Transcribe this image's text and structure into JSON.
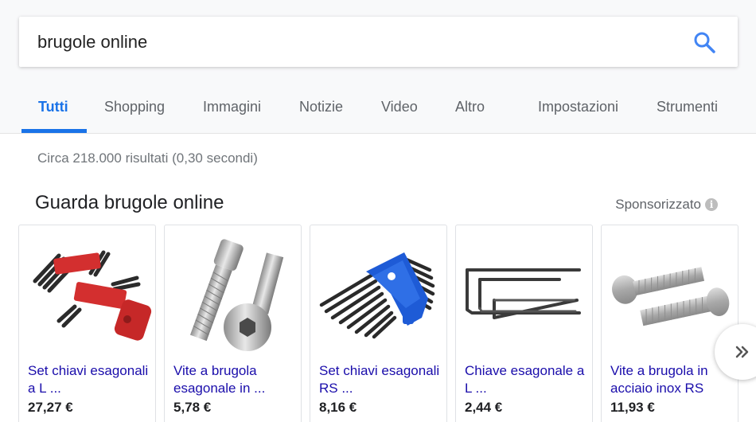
{
  "search": {
    "query": "brugole online"
  },
  "tabs": [
    {
      "label": "Tutti"
    },
    {
      "label": "Shopping"
    },
    {
      "label": "Immagini"
    },
    {
      "label": "Notizie"
    },
    {
      "label": "Video"
    },
    {
      "label": "Altro"
    },
    {
      "label": "Impostazioni"
    },
    {
      "label": "Strumenti"
    }
  ],
  "results": {
    "stats": "Circa 218.000 risultati (0,30 secondi)"
  },
  "shopping": {
    "title": "Guarda brugole online",
    "sponsored_label": "Sponsorizzato",
    "products": [
      {
        "title": "Set chiavi esagonali a L ...",
        "price": "27,27 €"
      },
      {
        "title": "Vite a brugola esagonale in ...",
        "price": "5,78 €"
      },
      {
        "title": "Set chiavi esagonali RS ...",
        "price": "8,16 €"
      },
      {
        "title": "Chiave esagonale a L ...",
        "price": "2,44 €"
      },
      {
        "title": "Vite a brugola in acciaio inox RS",
        "price": "11,93 €"
      }
    ]
  },
  "colors": {
    "accent": "#1a73e8",
    "link": "#1a0dab"
  }
}
